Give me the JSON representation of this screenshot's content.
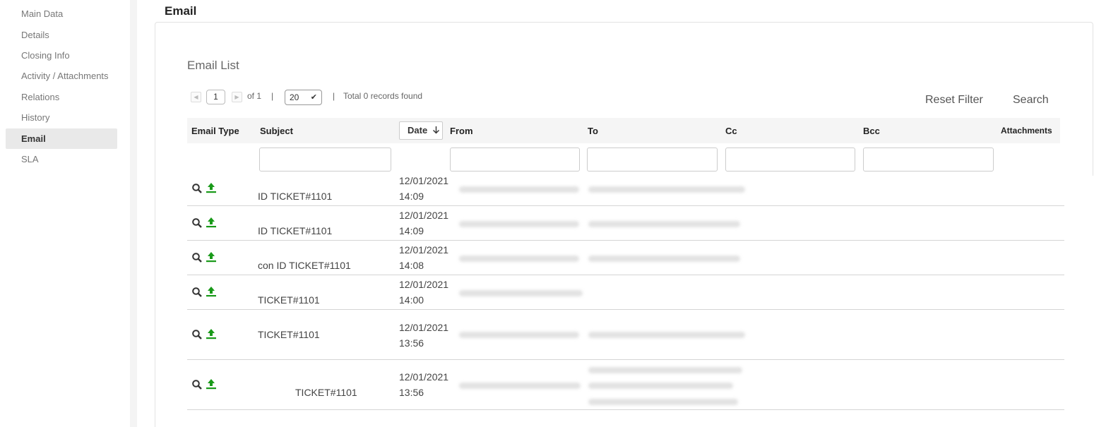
{
  "sidebar": {
    "items": [
      {
        "label": "Main Data"
      },
      {
        "label": "Details"
      },
      {
        "label": "Closing Info"
      },
      {
        "label": "Activity / Attachments"
      },
      {
        "label": "Relations"
      },
      {
        "label": "History"
      },
      {
        "label": "Email"
      },
      {
        "label": "SLA"
      }
    ]
  },
  "page": {
    "title": "Email"
  },
  "email_list": {
    "title": "Email List",
    "pager": {
      "prev_icon": "prev-page-icon",
      "next_icon": "next-page-icon",
      "current_page": "1",
      "of_text": "of 1",
      "separator": "|",
      "page_size": "20",
      "total_text": "Total 0 records found"
    },
    "reset_filter_label": "Reset Filter",
    "search_label": "Search",
    "columns": {
      "email_type": "Email Type",
      "subject": "Subject",
      "date": "Date",
      "date_sort_icon": "arrow-down-icon",
      "from": "From",
      "to": "To",
      "cc": "Cc",
      "bcc": "Bcc",
      "attachments": "Attachments"
    },
    "rows": [
      {
        "subject": "ID TICKET#1101",
        "date": "12/01/2021",
        "time": "14:09"
      },
      {
        "subject": "ID TICKET#1101",
        "date": "12/01/2021",
        "time": "14:09"
      },
      {
        "subject": "con ID TICKET#1101",
        "date": "12/01/2021",
        "time": "14:08"
      },
      {
        "subject": "TICKET#1101",
        "date": "12/01/2021",
        "time": "14:00"
      },
      {
        "subject": "TICKET#1101",
        "date": "12/01/2021",
        "time": "13:56"
      },
      {
        "subject": "TICKET#1101",
        "date": "12/01/2021",
        "time": "13:56"
      }
    ],
    "icons": {
      "view": "magnifier-icon",
      "export": "upload-green-icon"
    },
    "colors": {
      "export_icon": "#1a9a1a",
      "active_sidebar_bg": "#e9e9e9"
    }
  }
}
